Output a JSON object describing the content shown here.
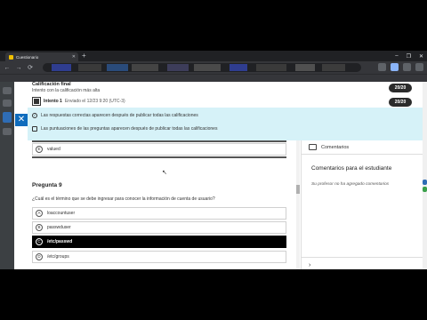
{
  "browser": {
    "tab_title": "Cuestionario",
    "tab_close": "✕",
    "new_tab": "+",
    "window_controls": [
      "–",
      "❐",
      "✕"
    ],
    "nav_back": "←",
    "nav_forward": "→",
    "nav_reload": "⟳"
  },
  "close_button_label": "✕",
  "summary": {
    "title": "Calificación final",
    "subtitle": "Intento con la calificación más alta",
    "final_score": "20/20",
    "attempt_label": "Intento 1",
    "attempt_date": "Enviado el 12/23 9:20 (UTC-3)",
    "attempt_score": "20/20"
  },
  "info": {
    "line1": "Las respuestas correctas aparecen después de publicar todas las calificaciones",
    "line2": "Las puntuaciones de las preguntas aparecen después de publicar todas las calificaciones"
  },
  "question8_last_option": {
    "letter": "E",
    "text": "valued"
  },
  "question9": {
    "title": "Pregunta 9",
    "text": "¿Cuál es el término que se debe ingresar para conocer la información de cuenta de usuario?",
    "options": [
      {
        "letter": "A",
        "text": "loaccountuser",
        "selected": false
      },
      {
        "letter": "B",
        "text": "passwduser",
        "selected": false
      },
      {
        "letter": "C",
        "text": "/etc/passwd",
        "selected": true
      },
      {
        "letter": "D",
        "text": "/etc/groups",
        "selected": false
      }
    ]
  },
  "comments": {
    "header": "Comentarios",
    "title": "Comentarios para el estudiante",
    "empty": "Su profesor no ha agregado comentarios",
    "expand": "›"
  },
  "colors": {
    "accent": "#0f6cbd",
    "info_bg": "#d6f2f8",
    "selected_bg": "#000000",
    "score_pill": "#2b2b2b"
  }
}
